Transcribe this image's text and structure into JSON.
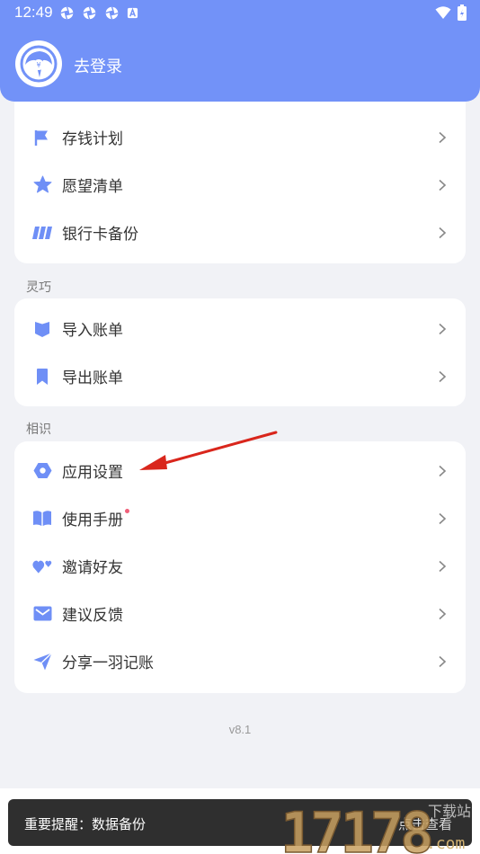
{
  "status_bar": {
    "time": "12:49"
  },
  "header": {
    "login_label": "去登录"
  },
  "card1": {
    "items": [
      {
        "label": "存钱计划",
        "icon": "flag-icon"
      },
      {
        "label": "愿望清单",
        "icon": "star-icon"
      },
      {
        "label": "银行卡备份",
        "icon": "card-stripes-icon"
      }
    ]
  },
  "section2": {
    "title": "灵巧",
    "items": [
      {
        "label": "导入账单",
        "icon": "shield-icon"
      },
      {
        "label": "导出账单",
        "icon": "bookmark-icon"
      }
    ]
  },
  "section3": {
    "title": "相识",
    "items": [
      {
        "label": "应用设置",
        "icon": "hexagon-gear-icon"
      },
      {
        "label": "使用手册",
        "icon": "book-icon"
      },
      {
        "label": "邀请好友",
        "icon": "hearts-icon"
      },
      {
        "label": "建议反馈",
        "icon": "mail-icon"
      },
      {
        "label": "分享一羽记账",
        "icon": "send-icon"
      }
    ]
  },
  "version": "v8.1",
  "toast": {
    "text": "重要提醒：数据备份",
    "action": "点击查看"
  },
  "watermark": {
    "text": "17178",
    "sub": "下载站",
    "domain": ".com"
  },
  "colors": {
    "accent": "#7292f8",
    "icon": "#6f8ff6",
    "dot": "#f0607a",
    "arrow": "#d9261c"
  }
}
